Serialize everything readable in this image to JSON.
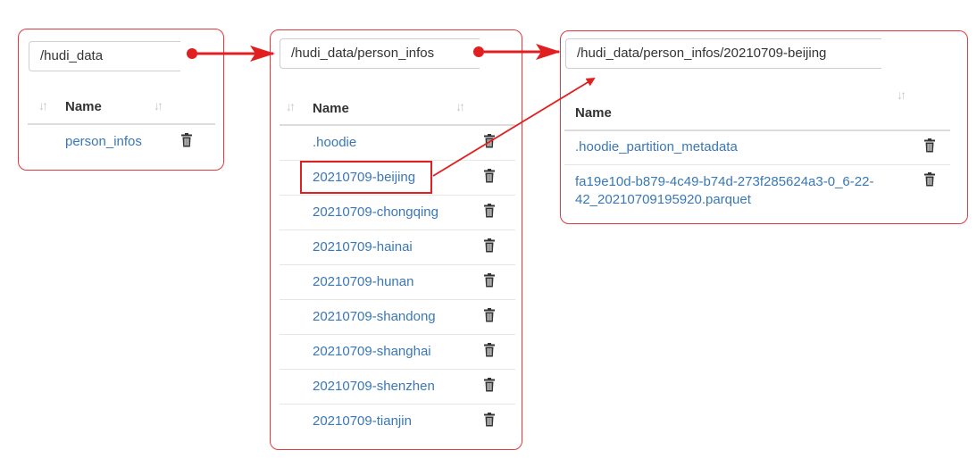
{
  "panels": [
    {
      "path": "/hudi_data",
      "column_header": "Name",
      "items": [
        "person_infos"
      ]
    },
    {
      "path": "/hudi_data/person_infos",
      "column_header": "Name",
      "items": [
        ".hoodie",
        "20210709-beijing",
        "20210709-chongqing",
        "20210709-hainai",
        "20210709-hunan",
        "20210709-shandong",
        "20210709-shanghai",
        "20210709-shenzhen",
        "20210709-tianjin"
      ]
    },
    {
      "path": "/hudi_data/person_infos/20210709-beijing",
      "column_header": "Name",
      "items": [
        ".hoodie_partition_metadata",
        "fa19e10d-b879-4c49-b74d-273f285624a3-0_6-22-",
        "42_20210709195920.parquet"
      ]
    }
  ],
  "icons": {
    "sort": "sort-arrows-icon",
    "delete": "trash-icon"
  },
  "colors": {
    "annotation": "#e02020",
    "link": "#3a77b5",
    "panel_border": "#e0393e"
  }
}
